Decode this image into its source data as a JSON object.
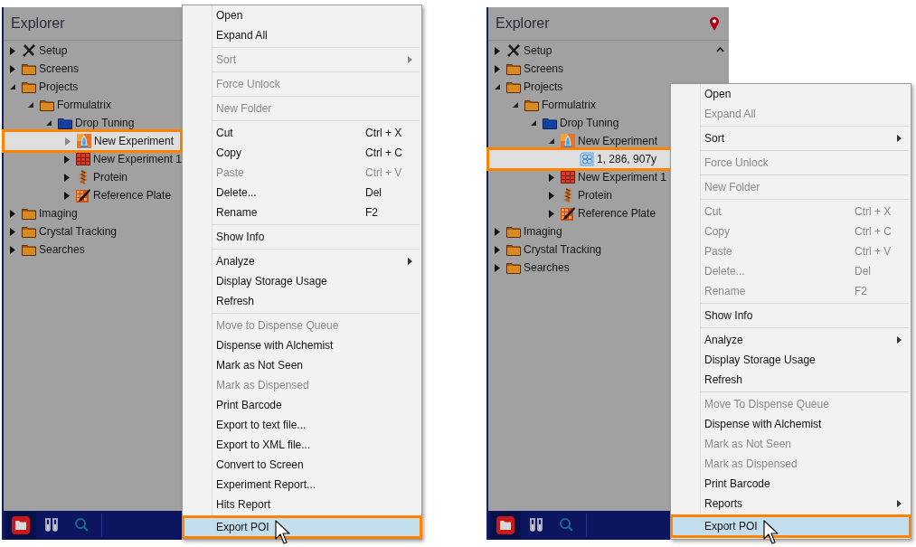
{
  "panels": [
    {
      "explorer": {
        "title": "Explorer",
        "pin": false,
        "scrollbar": false,
        "tree": [
          {
            "label": "Setup",
            "kind": "tools",
            "expanded": false,
            "selected": false
          },
          {
            "label": "Screens",
            "kind": "folder",
            "expanded": false,
            "selected": false
          },
          {
            "label": "Projects",
            "kind": "folder",
            "expanded": true,
            "selected": false,
            "children": [
              {
                "label": "Formulatrix",
                "kind": "folder",
                "expanded": true,
                "selected": false,
                "children": [
                  {
                    "label": "Drop Tuning",
                    "kind": "blue-folder",
                    "expanded": true,
                    "selected": false,
                    "children": [
                      {
                        "label": "New Experiment",
                        "kind": "experiment",
                        "expanded": false,
                        "selected": true
                      },
                      {
                        "label": "New Experiment 1",
                        "kind": "plate",
                        "expanded": false,
                        "selected": false
                      },
                      {
                        "label": "Protein",
                        "kind": "protein",
                        "expanded": false,
                        "selected": false
                      },
                      {
                        "label": "Reference Plate",
                        "kind": "reference-plate",
                        "expanded": false,
                        "selected": false
                      }
                    ]
                  }
                ]
              }
            ]
          },
          {
            "label": "Imaging",
            "kind": "folder",
            "expanded": false,
            "selected": false
          },
          {
            "label": "Crystal Tracking",
            "kind": "folder",
            "expanded": false,
            "selected": false
          },
          {
            "label": "Searches",
            "kind": "folder",
            "expanded": false,
            "selected": false
          }
        ],
        "tabs": [
          {
            "kind": "folder",
            "selected": true
          },
          {
            "kind": "tubes",
            "selected": false
          },
          {
            "kind": "search",
            "selected": false
          }
        ]
      },
      "menu": {
        "items": [
          {
            "kind": "item",
            "label": "Open",
            "disabled": false,
            "selected": false
          },
          {
            "kind": "item",
            "label": "Expand All",
            "disabled": false,
            "selected": false
          },
          {
            "kind": "separator"
          },
          {
            "kind": "item",
            "label": "Sort",
            "submenu": true,
            "disabled": true,
            "selected": false
          },
          {
            "kind": "separator"
          },
          {
            "kind": "item",
            "label": "Force Unlock",
            "disabled": true,
            "selected": false
          },
          {
            "kind": "separator"
          },
          {
            "kind": "item",
            "label": "New Folder",
            "disabled": true,
            "selected": false
          },
          {
            "kind": "separator"
          },
          {
            "kind": "item",
            "label": "Cut",
            "shortcut": "Ctrl + X",
            "disabled": false,
            "selected": false
          },
          {
            "kind": "item",
            "label": "Copy",
            "shortcut": "Ctrl + C",
            "disabled": false,
            "selected": false
          },
          {
            "kind": "item",
            "label": "Paste",
            "shortcut": "Ctrl + V",
            "disabled": true,
            "selected": false
          },
          {
            "kind": "item",
            "label": "Delete...",
            "shortcut": "Del",
            "disabled": false,
            "selected": false
          },
          {
            "kind": "item",
            "label": "Rename",
            "shortcut": "F2",
            "disabled": false,
            "selected": false
          },
          {
            "kind": "separator"
          },
          {
            "kind": "item",
            "label": "Show Info",
            "disabled": false,
            "selected": false
          },
          {
            "kind": "separator"
          },
          {
            "kind": "item",
            "label": "Analyze",
            "submenu": true,
            "disabled": false,
            "selected": false
          },
          {
            "kind": "item",
            "label": "Display Storage Usage",
            "disabled": false,
            "selected": false
          },
          {
            "kind": "item",
            "label": "Refresh",
            "disabled": false,
            "selected": false
          },
          {
            "kind": "separator"
          },
          {
            "kind": "item",
            "label": "Move to Dispense Queue",
            "disabled": true,
            "selected": false
          },
          {
            "kind": "item",
            "label": "Dispense with Alchemist",
            "disabled": false,
            "selected": false
          },
          {
            "kind": "item",
            "label": "Mark as Not Seen",
            "disabled": false,
            "selected": false
          },
          {
            "kind": "item",
            "label": "Mark as Dispensed",
            "disabled": true,
            "selected": false
          },
          {
            "kind": "item",
            "label": "Print Barcode",
            "disabled": false,
            "selected": false
          },
          {
            "kind": "item",
            "label": "Export to text file...",
            "disabled": false,
            "selected": false
          },
          {
            "kind": "item",
            "label": "Export to XML file...",
            "disabled": false,
            "selected": false
          },
          {
            "kind": "item",
            "label": "Convert to Screen",
            "disabled": false,
            "selected": false
          },
          {
            "kind": "item",
            "label": "Experiment Report...",
            "disabled": false,
            "selected": false
          },
          {
            "kind": "item",
            "label": "Hits Report",
            "disabled": false,
            "selected": false
          },
          {
            "kind": "item",
            "label": "Export POI",
            "disabled": false,
            "selected": true
          }
        ]
      }
    },
    {
      "explorer": {
        "title": "Explorer",
        "pin": true,
        "scrollbar": true,
        "tree": [
          {
            "label": "Setup",
            "kind": "tools",
            "expanded": false,
            "selected": false
          },
          {
            "label": "Screens",
            "kind": "folder",
            "expanded": false,
            "selected": false
          },
          {
            "label": "Projects",
            "kind": "folder",
            "expanded": true,
            "selected": false,
            "children": [
              {
                "label": "Formulatrix",
                "kind": "folder",
                "expanded": true,
                "selected": false,
                "children": [
                  {
                    "label": "Drop Tuning",
                    "kind": "blue-folder",
                    "expanded": true,
                    "selected": false,
                    "children": [
                      {
                        "label": "New Experiment",
                        "kind": "experiment",
                        "expanded": true,
                        "selected": false,
                        "children": [
                          {
                            "label": "1, 286, 907y",
                            "kind": "drop",
                            "selected": true
                          }
                        ]
                      },
                      {
                        "label": "New Experiment 1",
                        "kind": "plate",
                        "expanded": false,
                        "selected": false
                      },
                      {
                        "label": "Protein",
                        "kind": "protein",
                        "expanded": false,
                        "selected": false
                      },
                      {
                        "label": "Reference Plate",
                        "kind": "reference-plate",
                        "expanded": false,
                        "selected": false
                      }
                    ]
                  }
                ]
              }
            ]
          },
          {
            "label": "Imaging",
            "kind": "folder",
            "expanded": false,
            "selected": false
          },
          {
            "label": "Crystal Tracking",
            "kind": "folder",
            "expanded": false,
            "selected": false
          },
          {
            "label": "Searches",
            "kind": "folder",
            "expanded": false,
            "selected": false
          }
        ],
        "tabs": [
          {
            "kind": "folder",
            "selected": true
          },
          {
            "kind": "tubes",
            "selected": false
          },
          {
            "kind": "search",
            "selected": false
          }
        ]
      },
      "menu": {
        "items": [
          {
            "kind": "item",
            "label": "Open",
            "disabled": false,
            "selected": false
          },
          {
            "kind": "item",
            "label": "Expand All",
            "disabled": true,
            "selected": false
          },
          {
            "kind": "separator"
          },
          {
            "kind": "item",
            "label": "Sort",
            "submenu": true,
            "disabled": false,
            "selected": false
          },
          {
            "kind": "separator"
          },
          {
            "kind": "item",
            "label": "Force Unlock",
            "disabled": true,
            "selected": false
          },
          {
            "kind": "separator"
          },
          {
            "kind": "item",
            "label": "New Folder",
            "disabled": true,
            "selected": false
          },
          {
            "kind": "separator"
          },
          {
            "kind": "item",
            "label": "Cut",
            "shortcut": "Ctrl + X",
            "disabled": true,
            "selected": false
          },
          {
            "kind": "item",
            "label": "Copy",
            "shortcut": "Ctrl + C",
            "disabled": true,
            "selected": false
          },
          {
            "kind": "item",
            "label": "Paste",
            "shortcut": "Ctrl + V",
            "disabled": true,
            "selected": false
          },
          {
            "kind": "item",
            "label": "Delete...",
            "shortcut": "Del",
            "disabled": true,
            "selected": false
          },
          {
            "kind": "item",
            "label": "Rename",
            "shortcut": "F2",
            "disabled": true,
            "selected": false
          },
          {
            "kind": "separator"
          },
          {
            "kind": "item",
            "label": "Show Info",
            "disabled": false,
            "selected": false
          },
          {
            "kind": "separator"
          },
          {
            "kind": "item",
            "label": "Analyze",
            "submenu": true,
            "disabled": false,
            "selected": false
          },
          {
            "kind": "item",
            "label": "Display Storage Usage",
            "disabled": false,
            "selected": false
          },
          {
            "kind": "item",
            "label": "Refresh",
            "disabled": false,
            "selected": false
          },
          {
            "kind": "separator"
          },
          {
            "kind": "item",
            "label": "Move To Dispense Queue",
            "disabled": true,
            "selected": false
          },
          {
            "kind": "item",
            "label": "Dispense with Alchemist",
            "disabled": false,
            "selected": false
          },
          {
            "kind": "item",
            "label": "Mark as Not Seen",
            "disabled": true,
            "selected": false
          },
          {
            "kind": "item",
            "label": "Mark as Dispensed",
            "disabled": true,
            "selected": false
          },
          {
            "kind": "item",
            "label": "Print Barcode",
            "disabled": false,
            "selected": false
          },
          {
            "kind": "item",
            "label": "Reports",
            "submenu": true,
            "disabled": false,
            "selected": false
          },
          {
            "kind": "item",
            "label": "Export POI",
            "disabled": false,
            "selected": true
          }
        ]
      }
    }
  ]
}
